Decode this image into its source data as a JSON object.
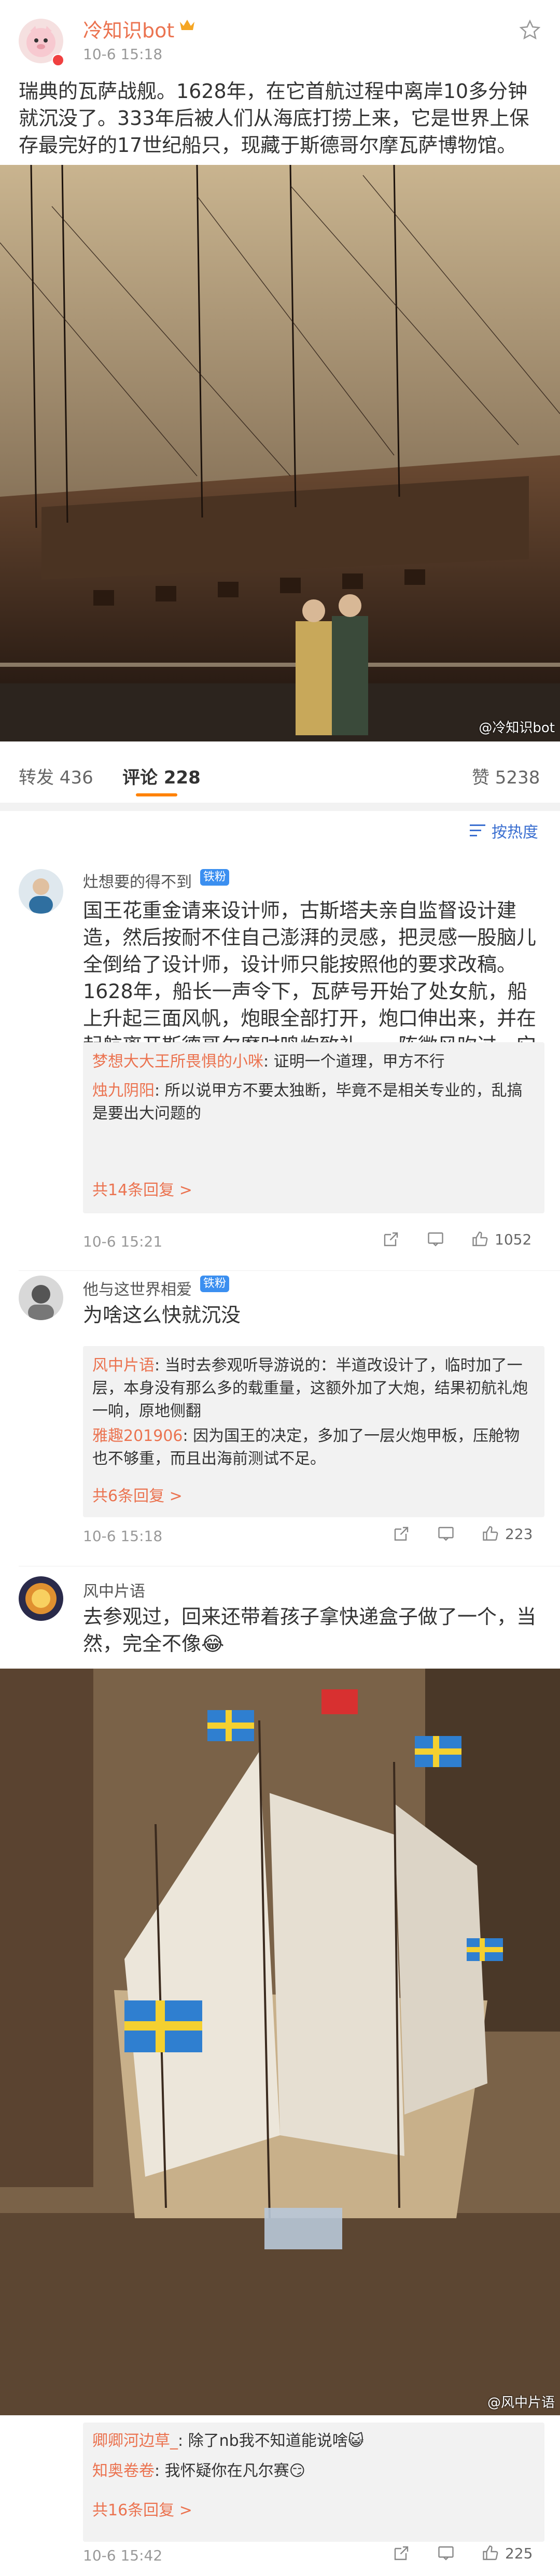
{
  "post": {
    "user": "冷知识bot",
    "time": "10-6 15:18",
    "text": "瑞典的瓦萨战舰。1628年，在它首航过程中离岸10多分钟就沉没了。333年后被人们从海底打捞上来，它是世界上保存最完好的17世纪船只，现藏于斯德哥尔摩瓦萨博物馆。",
    "watermark": "@冷知识bot"
  },
  "tabs": {
    "repost": "转发 436",
    "comment": "评论 228",
    "like": "赞 5238"
  },
  "sort": "按热度",
  "comments": [
    {
      "user": "灶想要的得不到",
      "badge": "铁粉",
      "text": "国王花重金请来设计师，古斯塔夫亲自监督设计建造，然后按耐不住自己澎湃的灵感，把灵感一股脑儿全倒给了设计师，设计师只能按照他的要求改稿。1628年，船长一声令下，瓦萨号开始了处女航，船上升起三面风帆，炮眼全部打开，炮口伸出来，并在起航离开斯德哥尔摩时鸣炮致礼。一阵微风吹过，它沉了。",
      "replies": [
        {
          "who": "梦想大大王所畏惧的小咪",
          "text": ": 证明一个道理，甲方不行"
        },
        {
          "who": "烛九阴阳",
          "text": ": 所以说甲方不要太独断，毕竟不是相关专业的，乱搞是要出大问题的"
        }
      ],
      "more": "共14条回复 >",
      "time": "10-6 15:21",
      "likes": "1052"
    },
    {
      "user": "他与这世界相爱",
      "badge": "铁粉",
      "text": "为啥这么快就沉没",
      "replies": [
        {
          "who": "风中片语",
          "text": ": 当时去参观听导游说的：半道改设计了，临时加了一层，本身没有那么多的载重量，这额外加了大炮，结果初航礼炮一响，原地侧翻"
        },
        {
          "who": "雅趣201906",
          "text": ": 因为国王的决定，多加了一层火炮甲板，压舱物也不够重，而且出海前测试不足。"
        }
      ],
      "more": "共6条回复 >",
      "time": "10-6 15:18",
      "likes": "223"
    },
    {
      "user": "风中片语",
      "text": "去参观过，回来还带着孩子拿快递盒子做了一个，当然，完全不像😂",
      "watermark": "@风中片语",
      "replies": [
        {
          "who": "卿卿河边草_",
          "text": ": 除了nb我不知道能说啥😺"
        },
        {
          "who": "知奥卷卷",
          "text": ": 我怀疑你在凡尔赛😏"
        }
      ],
      "more": "共16条回复 >",
      "time": "10-6 15:42",
      "likes": "225"
    }
  ],
  "colors": {
    "accent": "#eb7350",
    "badge": "#3b8ff0",
    "tab_underline": "#ff8200"
  }
}
